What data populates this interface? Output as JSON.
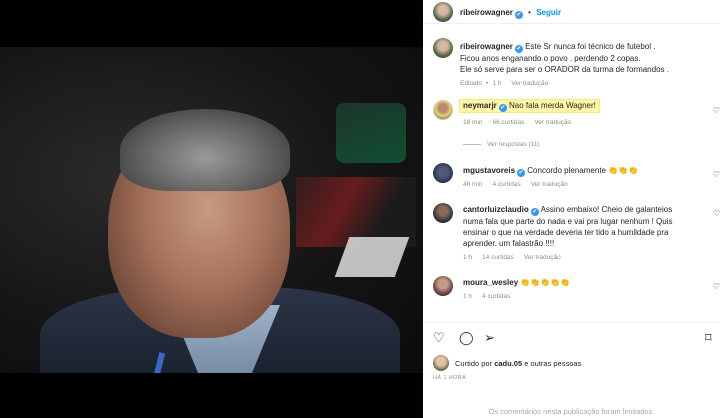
{
  "post": {
    "author": "ribeirowagner",
    "follow_label": "Seguir",
    "dot": "•"
  },
  "caption": {
    "user": "ribeirowagner",
    "line1": "Este Sr nunca foi técnico de futebol .",
    "line2": "Ficou anos enganando o povo . perdendo 2 copas.",
    "line3": "Ele só serve para ser o ORADOR da turma de formandos .",
    "edited": "Editado",
    "age": "1 h",
    "translate": "Ver tradução"
  },
  "comments": [
    {
      "user": "neymarjr",
      "text": "Nao fala merda Wagner!",
      "age": "18 min",
      "likes": "66 curtidas",
      "translate": "Ver tradução",
      "replies": "Ver respostas (11)"
    },
    {
      "user": "mgustavoreis",
      "text": "Concordo plenamente 👏👏👏",
      "age": "46 min",
      "likes": "4 curtidas",
      "translate": "Ver tradução"
    },
    {
      "user": "cantorluizclaudio",
      "text_line1": "Assino embaixo! Cheio de galanteios",
      "text_line2": "numa fala que parte do nada e vai pra lugar nenhum ! Quis",
      "text_line3": "ensinar o que na verdade deveria ter tido a humildade pra",
      "text_line4": "aprender. um falastrão !!!!",
      "age": "1 h",
      "likes": "14 curtidas",
      "translate": "Ver tradução"
    },
    {
      "user": "moura_wesley",
      "text": "👏👏👏👏👏",
      "age": "1 h",
      "likes": "4 curtidas"
    }
  ],
  "footer": {
    "liked_prefix": "Curtido por",
    "liked_user": "cadu.05",
    "liked_suffix": "e outras pessoas",
    "ago": "HÁ 1 HORA",
    "limited": "Os comentários nesta publicação foram limitados."
  },
  "icons": {
    "verified": "✔",
    "heart": "♡",
    "comment": "◯",
    "share": "➢",
    "bookmark": "⌑"
  },
  "colors": {
    "accent": "#0095f6",
    "verified": "#3897f0",
    "highlight": "#fff7a8"
  }
}
